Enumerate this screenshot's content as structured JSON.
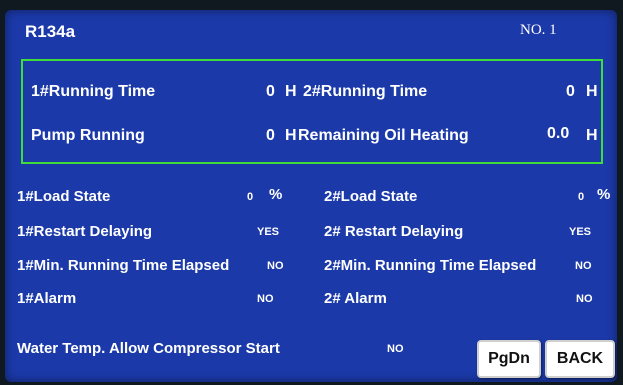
{
  "header": {
    "refrigerant": "R134a",
    "unit_no": "NO. 1"
  },
  "summary": {
    "running_time_1": {
      "label": "1#Running Time",
      "value": "0",
      "unit": "H"
    },
    "running_time_2": {
      "label": "2#Running Time",
      "value": "0",
      "unit": "H"
    },
    "pump_running": {
      "label": "Pump Running",
      "value": "0",
      "unit": "H"
    },
    "oil_heating": {
      "label": "Remaining Oil Heating",
      "value": "0.0",
      "unit": "H"
    }
  },
  "status": {
    "load_1": {
      "label": "1#Load State",
      "value": "0",
      "unit": "%"
    },
    "load_2": {
      "label": "2#Load State",
      "value": "0",
      "unit": "%"
    },
    "restart_1": {
      "label": "1#Restart Delaying",
      "value": "YES"
    },
    "restart_2": {
      "label": "2# Restart Delaying",
      "value": "YES"
    },
    "minrun_1": {
      "label": "1#Min. Running Time Elapsed",
      "value": "NO"
    },
    "minrun_2": {
      "label": "2#Min. Running Time Elapsed",
      "value": "NO"
    },
    "alarm_1": {
      "label": "1#Alarm",
      "value": "NO"
    },
    "alarm_2": {
      "label": "2# Alarm",
      "value": "NO"
    },
    "water_temp": {
      "label": "Water Temp. Allow Compressor Start",
      "value": "NO"
    }
  },
  "buttons": {
    "pgdn": "PgDn",
    "back": "BACK"
  },
  "colors": {
    "panel": "#1b39a8",
    "frame": "#3fdc3a",
    "text": "#ffffff"
  }
}
